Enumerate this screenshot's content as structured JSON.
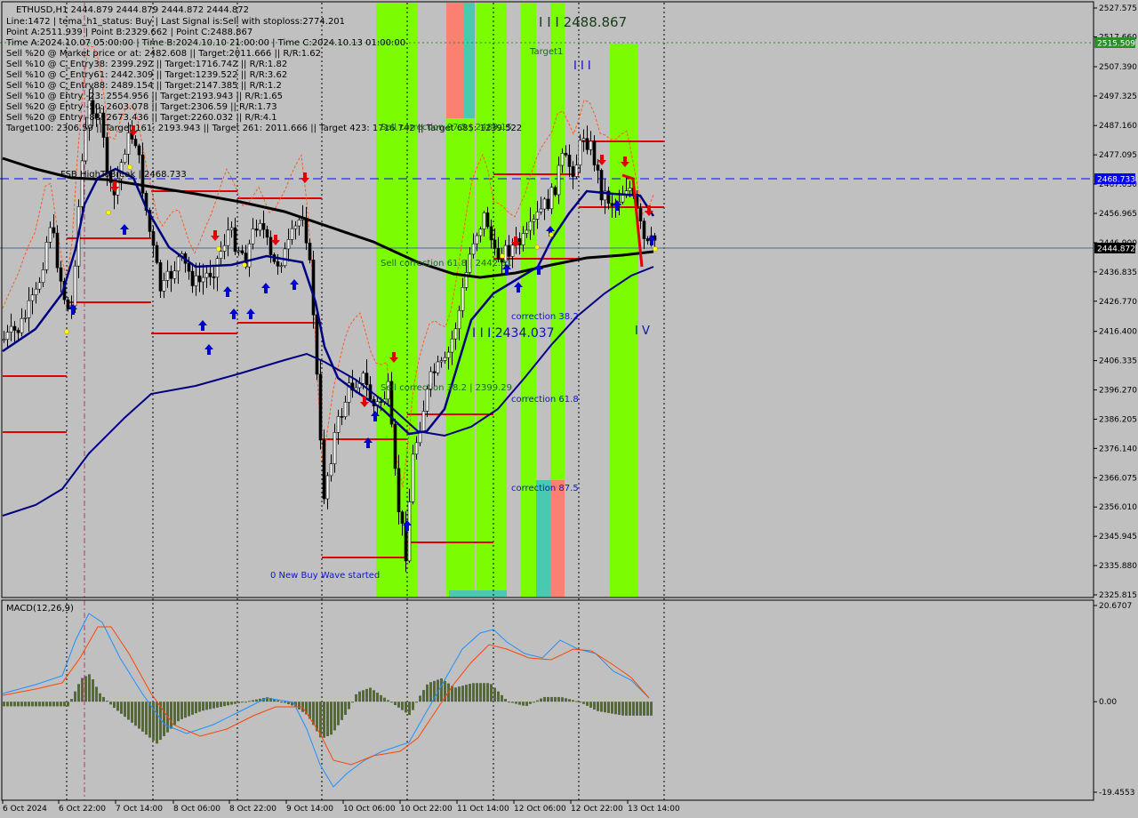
{
  "window": {
    "symbol_line": "ETHUSD,H1  2444.879 2444.879 2444.872 2444.872"
  },
  "info_lines": [
    "Line:1472 | tema_h1_status: Buy | Last Signal is:Sell with stoploss:2774.201",
    "Point A:2511.939 | Point B:2329.662 | Point C:2488.867",
    "Time A:2024.10.07 05:00:00 | Time B:2024.10.10 21:00:00 | Time C:2024.10.13 01:00:00",
    "Sell %20 @ Market price or at: 2482.608 || Target:2011.666 || R/R:1.62",
    "Sell %10 @ C_Entry38: 2399.292 || Target:1716.742 || R/R:1.82",
    "Sell %10 @ C_Entry61: 2442.309 || Target:1239.522 || R/R:3.62",
    "Sell %10 @ C_Entry88: 2489.154 || Target:2147.385 || R/R:1.2",
    "Sell %10 @ Entry -23: 2554.956 || Target:2193.943 || R/R:1.65",
    "Sell %20 @ Entry -50: 2603.078 || Target:2306.59 || R/R:1.73",
    "Sell %20 @ Entry -88: 2673.436 || Target:2260.032 || R/R:4.1",
    "Target100: 2306.59 || Target 161: 2193.943 || Target 261: 2011.666 || Target 423: 1716.742 || Target 685: 1239.522"
  ],
  "annotations": {
    "point_c": "I I I 2488.867",
    "point_b_wave": "I I I 2434.037",
    "wave_ii": "I I I",
    "wave_iv": "I V",
    "target1": "Target1",
    "fsb": "FSB HighToBreak | 2468.733",
    "sell_corr_87": "Sell correction 87.5 | 2489.15",
    "sell_corr_61": "Sell correction 61.8 | 2442.31",
    "sell_corr_38": "Sell correction 38.2 | 2399.29",
    "corr_38": "correction 38.2",
    "corr_61": "correction 61.8",
    "corr_87": "correction 87.5",
    "new_buy_wave": "0 New Buy Wave started"
  },
  "price_axis": {
    "ticks": [
      "2527.575",
      "2517.660",
      "2507.390",
      "2497.325",
      "2487.160",
      "2477.095",
      "2467.030",
      "2456.965",
      "2446.900",
      "2436.835",
      "2426.770",
      "2416.400",
      "2406.335",
      "2396.270",
      "2386.205",
      "2376.140",
      "2366.075",
      "2356.010",
      "2345.945",
      "2335.880",
      "2325.815"
    ],
    "current_price": "2444.872",
    "fsb_label": "2468.733",
    "target_label": "2515.509"
  },
  "macd": {
    "title": "MACD(12,26,9)",
    "ticks": [
      "20.6707",
      "0.00",
      "-19.4553"
    ]
  },
  "time_axis": [
    "6 Oct 2024",
    "6 Oct 22:00",
    "7 Oct 14:00",
    "8 Oct 06:00",
    "8 Oct 22:00",
    "9 Oct 14:00",
    "10 Oct 06:00",
    "10 Oct 22:00",
    "11 Oct 14:00",
    "12 Oct 06:00",
    "12 Oct 22:00",
    "13 Oct 14:00"
  ],
  "colors": {
    "background": "#c0c0c0",
    "green_zone": "#7cfc00",
    "salmon_zone": "#fa8072",
    "teal_zone": "#48c9b0",
    "ma_black": "#000000",
    "ma_navy": "#000080",
    "fsb_blue": "#0000ff",
    "level_red": "#e00000",
    "macd_hist": "#556b2f",
    "macd_line": "#1e90ff",
    "signal_line": "#ff4500"
  },
  "chart_data": {
    "type": "line",
    "title": "ETHUSD,H1",
    "ylim": [
      2325.815,
      2527.575
    ],
    "x": [
      "6 Oct 2024",
      "6 Oct 22:00",
      "7 Oct 14:00",
      "8 Oct 06:00",
      "8 Oct 22:00",
      "9 Oct 14:00",
      "10 Oct 06:00",
      "10 Oct 22:00",
      "11 Oct 14:00",
      "12 Oct 06:00",
      "12 Oct 22:00",
      "13 Oct 14:00"
    ],
    "series": [
      {
        "name": "ETHUSD",
        "values": [
          2422,
          2432,
          2480,
          2450,
          2455,
          2435,
          2405,
          2340,
          2420,
          2455,
          2485,
          2445
        ]
      }
    ],
    "macd": {
      "title": "MACD(12,26,9)",
      "ylim": [
        -19.4553,
        20.6707
      ],
      "values": [
        -5,
        12,
        -6,
        -10,
        2,
        -8,
        -16,
        -7,
        8,
        -3,
        4,
        -2
      ]
    }
  }
}
